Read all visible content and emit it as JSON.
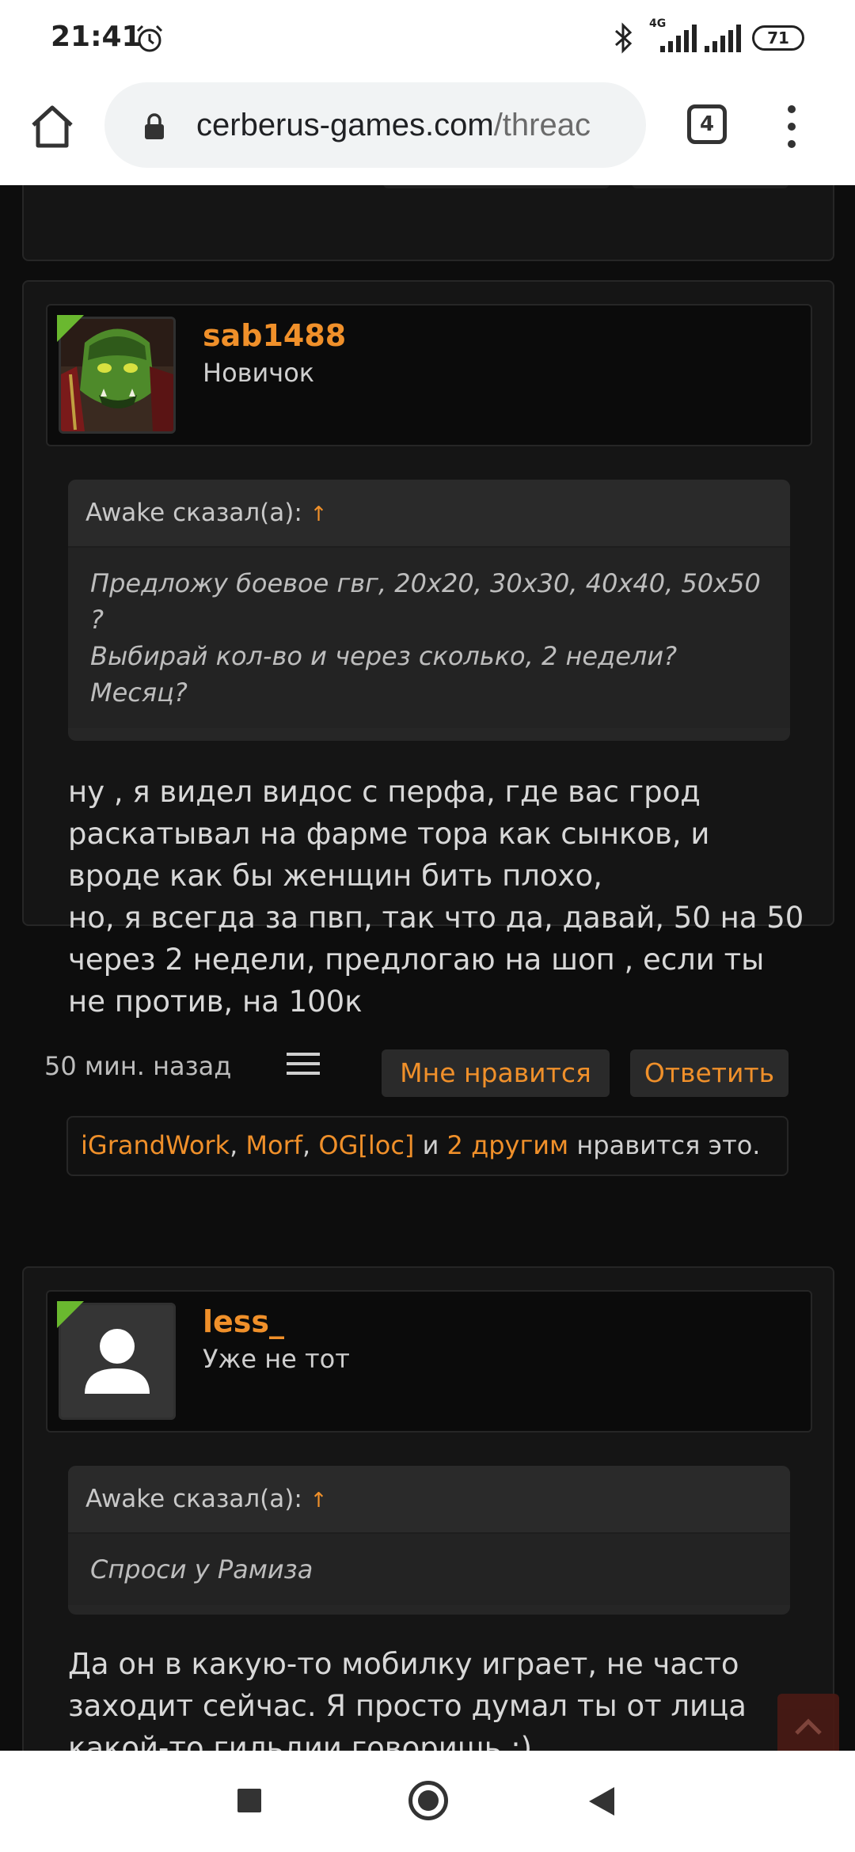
{
  "status_bar": {
    "time": "21:41",
    "network": "4G",
    "battery": "71"
  },
  "browser": {
    "url_domain": "cerberus-games.com",
    "url_path": "/threac",
    "tab_count": "4"
  },
  "posts": [
    {
      "username": "sab1488",
      "user_title": "Новичок",
      "quote_author": "Awake сказал(а):",
      "quote_arrow": "↑",
      "quote_lines": [
        "Предложу боевое гвг, 20х20, 30х30, 40х40, 50х50",
        "?",
        "Выбирай кол-во и через сколько, 2 недели?",
        "Месяц?"
      ],
      "text_lines": [
        "ну , я видел видос с перфа, где вас грод",
        "раскатывал на фарме тора как сынков, и",
        "вроде как бы женщин бить плохо,",
        "но, я всегда за пвп, так что да, давай, 50 на 50",
        "через 2 недели, предлогаю на шоп , если ты",
        "не против, на 100к"
      ],
      "time_ago": "50 мин. назад",
      "like_label": "Мне нравится",
      "reply_label": "Ответить",
      "likes": {
        "user1": "iGrandWork",
        "sep1": ",",
        "user2": "Morf",
        "sep2": ",",
        "user3": "OG[loc]",
        "and": "и",
        "others": "2 другим",
        "suffix": "нравится это."
      }
    },
    {
      "username": "less_",
      "user_title": "Уже не тот",
      "quote_author": "Awake сказал(а):",
      "quote_arrow": "↑",
      "quote_lines": [
        "Спроси у Рамиза"
      ],
      "text_lines": [
        "Да он в какую-то мобилку играет, не часто",
        "заходит сейчас. Я просто думал ты от лица",
        "какой-то гильдии говоришь :)"
      ]
    }
  ],
  "colors": {
    "accent": "#f0902a",
    "online": "#6ab82f",
    "background": "#0d0d0d",
    "card": "#151515"
  },
  "icons": {
    "avatar_1": "orc-avatar",
    "avatar_2": "default-user-avatar",
    "share": "hamburger-menu-icon",
    "scroll_top": "chevron-up-icon"
  }
}
